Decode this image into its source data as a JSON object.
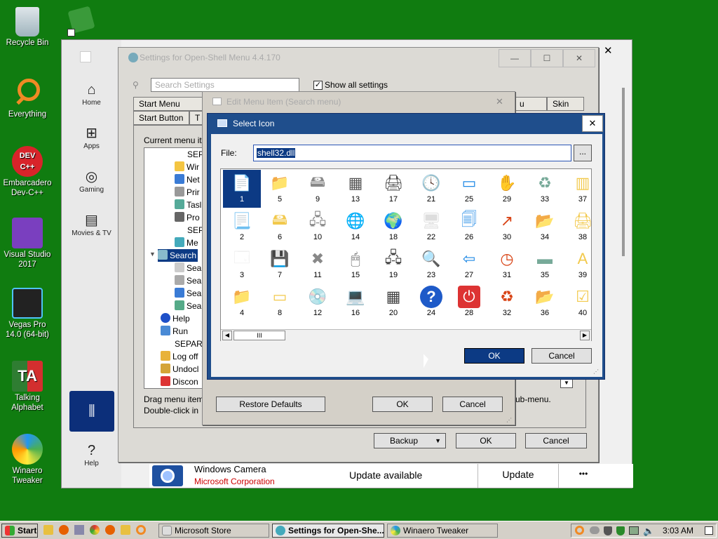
{
  "desktop_icons": [
    {
      "name": "recycle-bin-icon",
      "label": "Recycle Bin"
    },
    {
      "name": "everything-icon",
      "label": "Everything"
    },
    {
      "name": "devcpp-icon",
      "label": "Embarcadero Dev-C++"
    },
    {
      "name": "visual-studio-icon",
      "label": "Visual Studio 2017"
    },
    {
      "name": "vegas-pro-icon",
      "label": "Vegas Pro 14.0 (64-bit)"
    },
    {
      "name": "talking-alphabet-icon",
      "label": "Talking Alphabet"
    },
    {
      "name": "winaero-tweaker-icon",
      "label": "Winaero Tweaker"
    }
  ],
  "store": {
    "nav": [
      "Home",
      "Apps",
      "Gaming",
      "Movies & TV",
      "Help"
    ],
    "camera_app": "Windows Camera",
    "camera_publisher": "Microsoft Corporation",
    "status": "Update available",
    "update_label": "Update",
    "more_label": "•••"
  },
  "settings": {
    "title": "Settings for Open-Shell Menu 4.4.170",
    "search_placeholder": "Search Settings",
    "show_all": "Show all settings",
    "tabs_row1": [
      "Start Menu Style",
      "u Look",
      "Skin"
    ],
    "tabs_row2": [
      "Start Button",
      "T"
    ],
    "current_label": "Current menu it",
    "tree_items": [
      "SEP",
      "Wir",
      "Net",
      "Prir",
      "Tasl",
      "Pro",
      "SEP",
      "Me",
      "Search",
      "Sea",
      "Sea",
      "Sea",
      "Sea",
      "Help",
      "Run",
      "SEPARA",
      "Log off",
      "Undocl",
      "Discon"
    ],
    "drag_hint": "Drag menu item",
    "dbl_hint": "Double-click in",
    "submenu_hint": "ub-menu.",
    "backup": "Backup",
    "ok": "OK",
    "cancel": "Cancel"
  },
  "edit_item": {
    "title": "Edit Menu Item (Search menu)",
    "restore": "Restore Defaults",
    "ok": "OK",
    "cancel": "Cancel"
  },
  "select_icon": {
    "title": "Select Icon",
    "file_label": "File:",
    "file_value": "shell32.dll",
    "browse": "...",
    "ok": "OK",
    "cancel": "Cancel",
    "icons": [
      {
        "n": "1",
        "g": "📄"
      },
      {
        "n": "5",
        "g": "📁"
      },
      {
        "n": "9",
        "g": "🖴"
      },
      {
        "n": "13",
        "g": "▦"
      },
      {
        "n": "17",
        "g": "🖨"
      },
      {
        "n": "21",
        "g": "🕓"
      },
      {
        "n": "25",
        "g": "▭"
      },
      {
        "n": "29",
        "g": "✋"
      },
      {
        "n": "33",
        "g": "♻"
      },
      {
        "n": "37",
        "g": "▥"
      },
      {
        "n": "2",
        "g": "📃"
      },
      {
        "n": "6",
        "g": "🖴"
      },
      {
        "n": "10",
        "g": "🖧"
      },
      {
        "n": "14",
        "g": "🌐"
      },
      {
        "n": "18",
        "g": "🌍"
      },
      {
        "n": "22",
        "g": "🖥"
      },
      {
        "n": "26",
        "g": "🗐"
      },
      {
        "n": "30",
        "g": "↗"
      },
      {
        "n": "34",
        "g": "📂"
      },
      {
        "n": "38",
        "g": "🖨"
      },
      {
        "n": "3",
        "g": "🗔"
      },
      {
        "n": "7",
        "g": "💾"
      },
      {
        "n": "11",
        "g": "✖"
      },
      {
        "n": "15",
        "g": "🖱"
      },
      {
        "n": "19",
        "g": "🖧"
      },
      {
        "n": "23",
        "g": "🔍"
      },
      {
        "n": "27",
        "g": "⇦"
      },
      {
        "n": "31",
        "g": "◷"
      },
      {
        "n": "35",
        "g": "▬"
      },
      {
        "n": "39",
        "g": "A"
      },
      {
        "n": "4",
        "g": "📁"
      },
      {
        "n": "8",
        "g": "▭"
      },
      {
        "n": "12",
        "g": "💿"
      },
      {
        "n": "16",
        "g": "💻"
      },
      {
        "n": "20",
        "g": "▦"
      },
      {
        "n": "24",
        "g": "?"
      },
      {
        "n": "28",
        "g": "⏻"
      },
      {
        "n": "32",
        "g": "♻"
      },
      {
        "n": "36",
        "g": "📂"
      },
      {
        "n": "40",
        "g": "☑"
      }
    ],
    "scroll_thumb": "III"
  },
  "taskbar": {
    "start": "Start",
    "buttons": [
      "Microsoft Store",
      "Settings for Open-She...",
      "Winaero Tweaker"
    ],
    "time": "3:03 AM"
  },
  "colors": {
    "desktop": "#107c10",
    "select_blue": "#0c3a84",
    "dialog_blue": "#1f4e8c"
  }
}
